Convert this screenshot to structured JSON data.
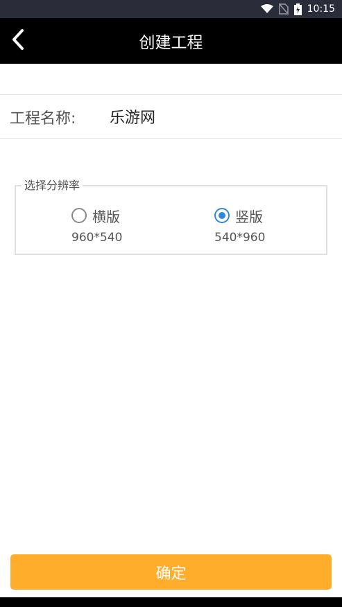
{
  "status_bar": {
    "time": "10:15",
    "icons": [
      "wifi-icon",
      "no-sim-icon",
      "battery-charging-icon"
    ]
  },
  "app_bar": {
    "title": "创建工程",
    "back_icon": "chevron-left-icon"
  },
  "project_name": {
    "label": "工程名称:",
    "value": "乐游网"
  },
  "resolution": {
    "legend": "选择分辨率",
    "options": [
      {
        "label": "横版",
        "size": "960*540",
        "checked": false
      },
      {
        "label": "竖版",
        "size": "540*960",
        "checked": true
      }
    ],
    "accent_color": "#2f87e0"
  },
  "confirm": {
    "label": "确定",
    "color": "#ffad2a"
  }
}
